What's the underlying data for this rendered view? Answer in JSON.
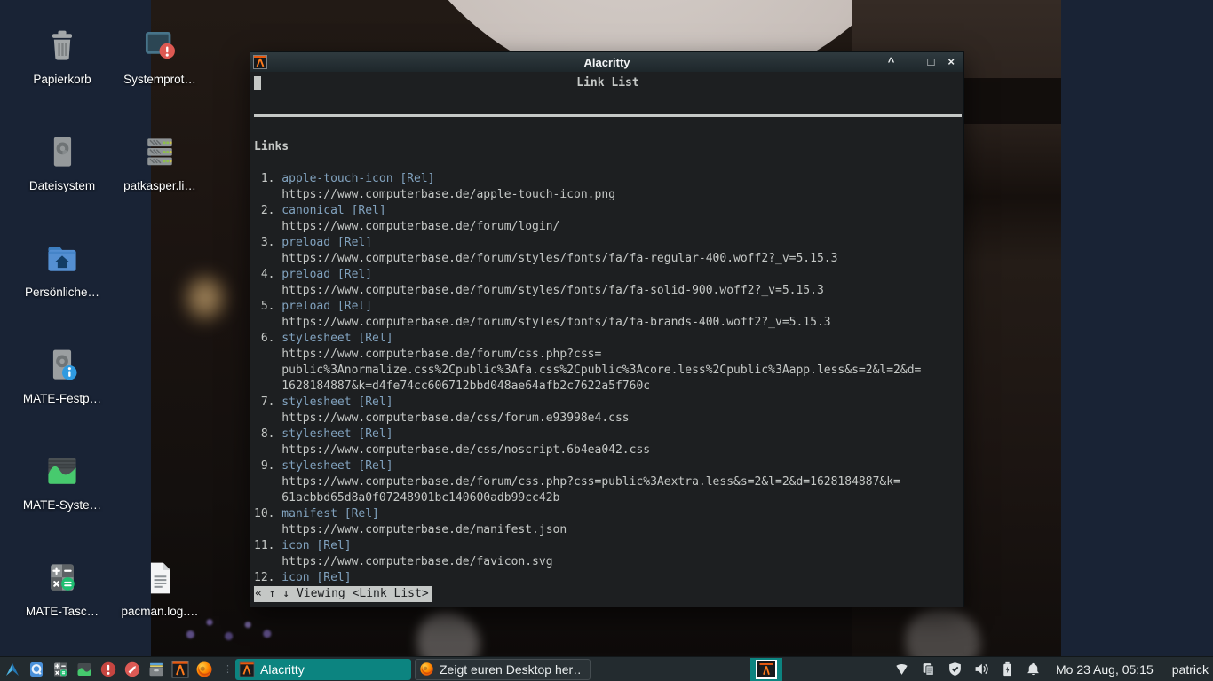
{
  "window": {
    "title": "Alacritty",
    "buttons": {
      "shade": "^",
      "minimize": "_",
      "maximize": "□",
      "close": "×"
    }
  },
  "terminal": {
    "page_title": "Link List",
    "section_heading": "Links",
    "rel_suffix": "[Rel]",
    "status": "« ↑ ↓ Viewing <Link List>",
    "links": [
      {
        "name": "apple-touch-icon",
        "url_lines": [
          "https://www.computerbase.de/apple-touch-icon.png"
        ]
      },
      {
        "name": "canonical",
        "url_lines": [
          "https://www.computerbase.de/forum/login/"
        ]
      },
      {
        "name": "preload",
        "url_lines": [
          "https://www.computerbase.de/forum/styles/fonts/fa/fa-regular-400.woff2?_v=5.15.3"
        ]
      },
      {
        "name": "preload",
        "url_lines": [
          "https://www.computerbase.de/forum/styles/fonts/fa/fa-solid-900.woff2?_v=5.15.3"
        ]
      },
      {
        "name": "preload",
        "url_lines": [
          "https://www.computerbase.de/forum/styles/fonts/fa/fa-brands-400.woff2?_v=5.15.3"
        ]
      },
      {
        "name": "stylesheet",
        "url_lines": [
          "https://www.computerbase.de/forum/css.php?css=",
          "public%3Anormalize.css%2Cpublic%3Afa.css%2Cpublic%3Acore.less%2Cpublic%3Aapp.less&s=2&l=2&d=",
          "1628184887&k=d4fe74cc606712bbd048ae64afb2c7622a5f760c"
        ]
      },
      {
        "name": "stylesheet",
        "url_lines": [
          "https://www.computerbase.de/css/forum.e93998e4.css"
        ]
      },
      {
        "name": "stylesheet",
        "url_lines": [
          "https://www.computerbase.de/css/noscript.6b4ea042.css"
        ]
      },
      {
        "name": "stylesheet",
        "url_lines": [
          "https://www.computerbase.de/forum/css.php?css=public%3Aextra.less&s=2&l=2&d=1628184887&k=",
          "61acbbd65d8a0f07248901bc140600adb99cc42b"
        ]
      },
      {
        "name": "manifest",
        "url_lines": [
          "https://www.computerbase.de/manifest.json"
        ]
      },
      {
        "name": "icon",
        "url_lines": [
          "https://www.computerbase.de/favicon.svg"
        ]
      },
      {
        "name": "icon",
        "url_lines": []
      }
    ]
  },
  "desktop": {
    "icons": [
      {
        "label": "Papierkorb",
        "icon": "trash-icon"
      },
      {
        "label": "Systemprot…",
        "icon": "system-log-icon"
      },
      {
        "label": "Dateisystem",
        "icon": "filesystem-icon"
      },
      {
        "label": "patkasper.li…",
        "icon": "server-icon"
      },
      {
        "label": "Persönliche…",
        "icon": "home-folder-icon"
      },
      {
        "label": "MATE-Festp…",
        "icon": "disk-info-icon"
      },
      {
        "label": "MATE-Syste…",
        "icon": "system-monitor-icon"
      },
      {
        "label": "MATE-Tasc…",
        "icon": "calculator-icon"
      },
      {
        "label": "pacman.log.…",
        "icon": "text-file-icon"
      }
    ]
  },
  "taskbar": {
    "launchers": [
      "mate-menu",
      "caja-file-manager",
      "calculator",
      "system-monitor",
      "log-viewer",
      "pluma-editor",
      "archive-manager",
      "alacritty",
      "firefox"
    ],
    "tasks": [
      {
        "label": "Alacritty",
        "active": true
      },
      {
        "label": "Zeigt euren Desktop her…",
        "active": false
      }
    ],
    "tray_icons": [
      "wifi",
      "clipboard",
      "shield-check",
      "volume",
      "battery",
      "notifications"
    ],
    "clock": "Mo 23 Aug, 05:15",
    "user": "patrick"
  },
  "colors": {
    "accent_teal": "#0c8480",
    "terminal_bg": "#1d1f21",
    "terminal_fg": "#c5c8c6",
    "terminal_link": "#81a2be",
    "panel_bg": "#232b2f",
    "desktop_band": "#192335",
    "alacritty_orange": "#ff7a1a"
  }
}
